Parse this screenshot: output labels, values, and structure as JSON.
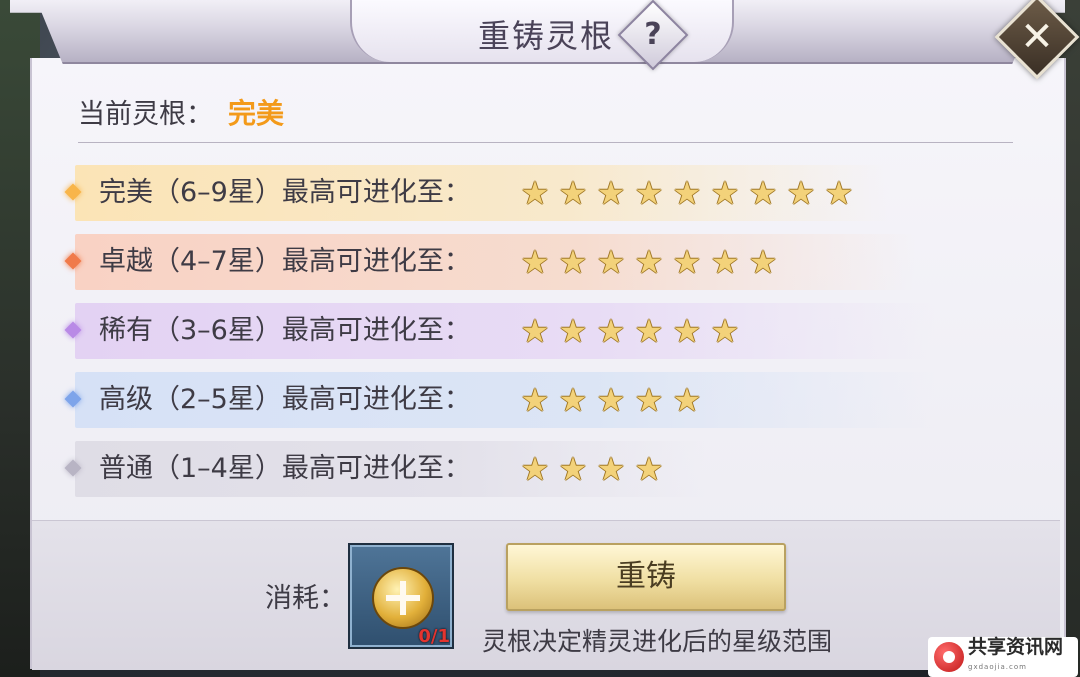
{
  "dialog": {
    "title": "重铸灵根",
    "help_glyph": "?",
    "close_glyph": "✕"
  },
  "current": {
    "label": "当前灵根：",
    "value": "完美",
    "value_color": "#f39a1a"
  },
  "tiers": [
    {
      "text": "完美（6–9星）最高可进化至：",
      "max_stars": 9,
      "color": "#f8b54a"
    },
    {
      "text": "卓越（4–7星）最高可进化至：",
      "max_stars": 7,
      "color": "#f07a4a"
    },
    {
      "text": "稀有（3–6星）最高可进化至：",
      "max_stars": 6,
      "color": "#b98ae6"
    },
    {
      "text": "高级（2–5星）最高可进化至：",
      "max_stars": 5,
      "color": "#7ea4ea"
    },
    {
      "text": "普通（1–4星）最高可进化至：",
      "max_stars": 4,
      "color": "#b8b4c4"
    }
  ],
  "cost": {
    "label": "消耗：",
    "item_icon": "gold-coin-plus-icon",
    "count": "0/1"
  },
  "recast_button": "重铸",
  "hint": "灵根决定精灵进化后的星级范围",
  "watermark": {
    "text": "共享资讯网",
    "sub": "gxdaojia.com"
  }
}
